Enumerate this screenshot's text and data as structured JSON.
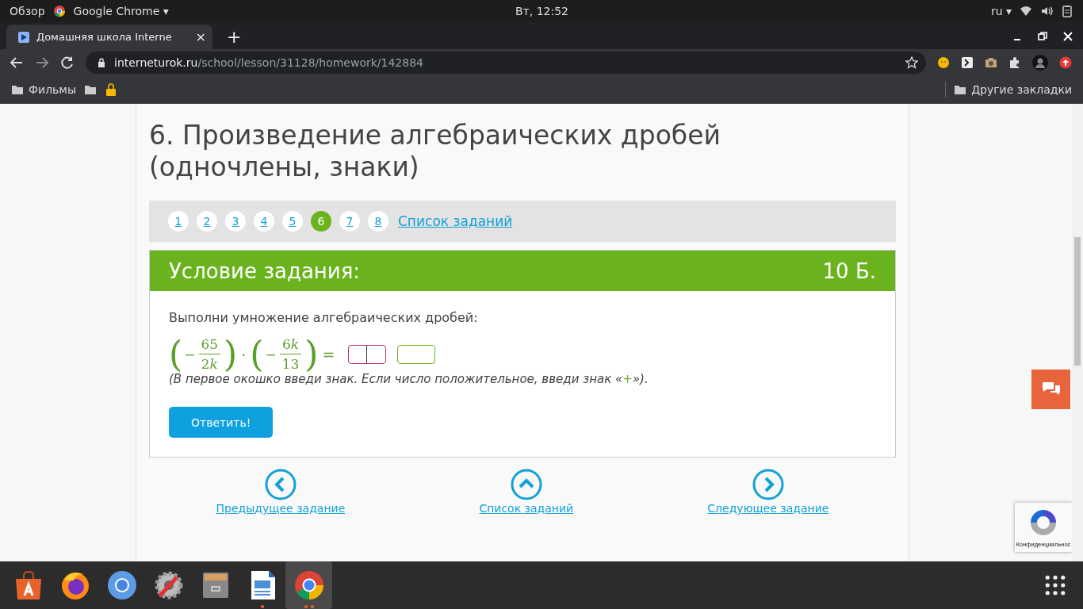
{
  "top_bar": {
    "activities": "Обзор",
    "app_menu": "Google Chrome ▾",
    "clock": "Вт, 12:52",
    "language": "ru ▾"
  },
  "browser": {
    "tab": {
      "title": "Домашняя школа Interne",
      "close": "×"
    },
    "new_tab": "+",
    "url": {
      "host": "interneturok.ru",
      "path": "/school/lesson/31128/homework/142884"
    },
    "bookmarks": [
      {
        "kind": "folder",
        "label": "Фильмы"
      },
      {
        "kind": "folder"
      },
      {
        "kind": "lock"
      }
    ],
    "other_bookmarks": "Другие закладки"
  },
  "page": {
    "title": "6. Произведение алгебраических дробей (одночлены, знаки)",
    "task_nav": [
      {
        "label": "1",
        "selected": false
      },
      {
        "label": "2",
        "selected": false
      },
      {
        "label": "3",
        "selected": false
      },
      {
        "label": "4",
        "selected": false
      },
      {
        "label": "5",
        "selected": false
      },
      {
        "label": "6",
        "selected": true
      },
      {
        "label": "7",
        "selected": false
      },
      {
        "label": "8",
        "selected": false
      }
    ],
    "task_list_link": "Список заданий",
    "header": {
      "title": "Условие задания:",
      "points": "10 Б."
    },
    "instruction": "Выполни умножение алгебраических дробей:",
    "formula": {
      "factors": [
        {
          "open": "(",
          "sign": "−",
          "numerator": {
            "digits": "65"
          },
          "denominator": {
            "digits": "2",
            "variable": "k"
          },
          "close": ")"
        },
        {
          "open": "(",
          "sign": "−",
          "numerator": {
            "digits": "6",
            "variable": "k"
          },
          "denominator": {
            "digits": "13"
          },
          "close": ")"
        }
      ],
      "operator": "·",
      "equals": "="
    },
    "answer_fields": [
      {
        "kind": "sign"
      },
      {
        "kind": "number"
      }
    ],
    "note": {
      "before": "(В первое окошко введи знак. Если число положительное, введи знак «",
      "sign": "+",
      "after": "»)."
    },
    "submit": "Ответить!",
    "bottom_nav": [
      {
        "kind": "left",
        "label": "Предыдущее задание"
      },
      {
        "kind": "up",
        "label": "Список заданий"
      },
      {
        "kind": "right",
        "label": "Следующее задание"
      }
    ],
    "recaptcha": "Конфиденциальнос"
  },
  "dock": [
    {
      "kind": "store",
      "running": false,
      "multiple_windows": false,
      "selected": false
    },
    {
      "kind": "firefox",
      "running": false,
      "multiple_windows": false,
      "selected": false
    },
    {
      "kind": "chromium",
      "running": false,
      "multiple_windows": false,
      "selected": false
    },
    {
      "kind": "settings",
      "running": false,
      "multiple_windows": false,
      "selected": false
    },
    {
      "kind": "files",
      "running": false,
      "multiple_windows": false,
      "selected": false
    },
    {
      "kind": "writer",
      "running": true,
      "multiple_windows": false,
      "selected": false
    },
    {
      "kind": "chrome",
      "running": true,
      "multiple_windows": true,
      "selected": true
    }
  ]
}
